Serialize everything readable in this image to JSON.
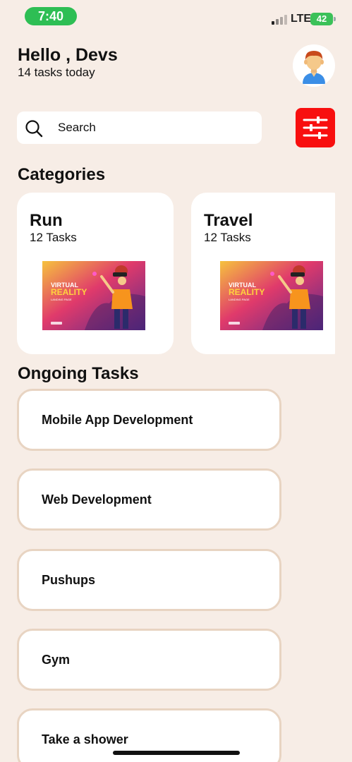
{
  "status_bar": {
    "time": "7:40",
    "network": "LTE",
    "battery": "42"
  },
  "header": {
    "greeting": "Hello , Devs",
    "subtitle": "14 tasks today",
    "avatar_icon": "user-avatar-icon"
  },
  "search": {
    "placeholder": "Search",
    "value": "",
    "icon": "search-icon"
  },
  "filter": {
    "icon": "sliders-icon",
    "color": "#F80F0F"
  },
  "categories": {
    "title": "Categories",
    "items": [
      {
        "title": "Run",
        "count": "12 Tasks",
        "image_text_1": "VIRTUAL",
        "image_text_2": "REALITY",
        "image_text_3": "LANDING PAGE"
      },
      {
        "title": "Travel",
        "count": "12 Tasks",
        "image_text_1": "VIRTUAL",
        "image_text_2": "REALITY",
        "image_text_3": "LANDING PAGE"
      }
    ]
  },
  "ongoing": {
    "title": "Ongoing Tasks",
    "items": [
      {
        "label": "Mobile App Development"
      },
      {
        "label": "Web Development"
      },
      {
        "label": "Pushups"
      },
      {
        "label": "Gym"
      },
      {
        "label": "Take a shower"
      }
    ]
  },
  "colors": {
    "background": "#F7EDE6",
    "accent_red": "#F80F0F",
    "time_green": "#2EBE54",
    "task_border": "#E8D4C2"
  }
}
